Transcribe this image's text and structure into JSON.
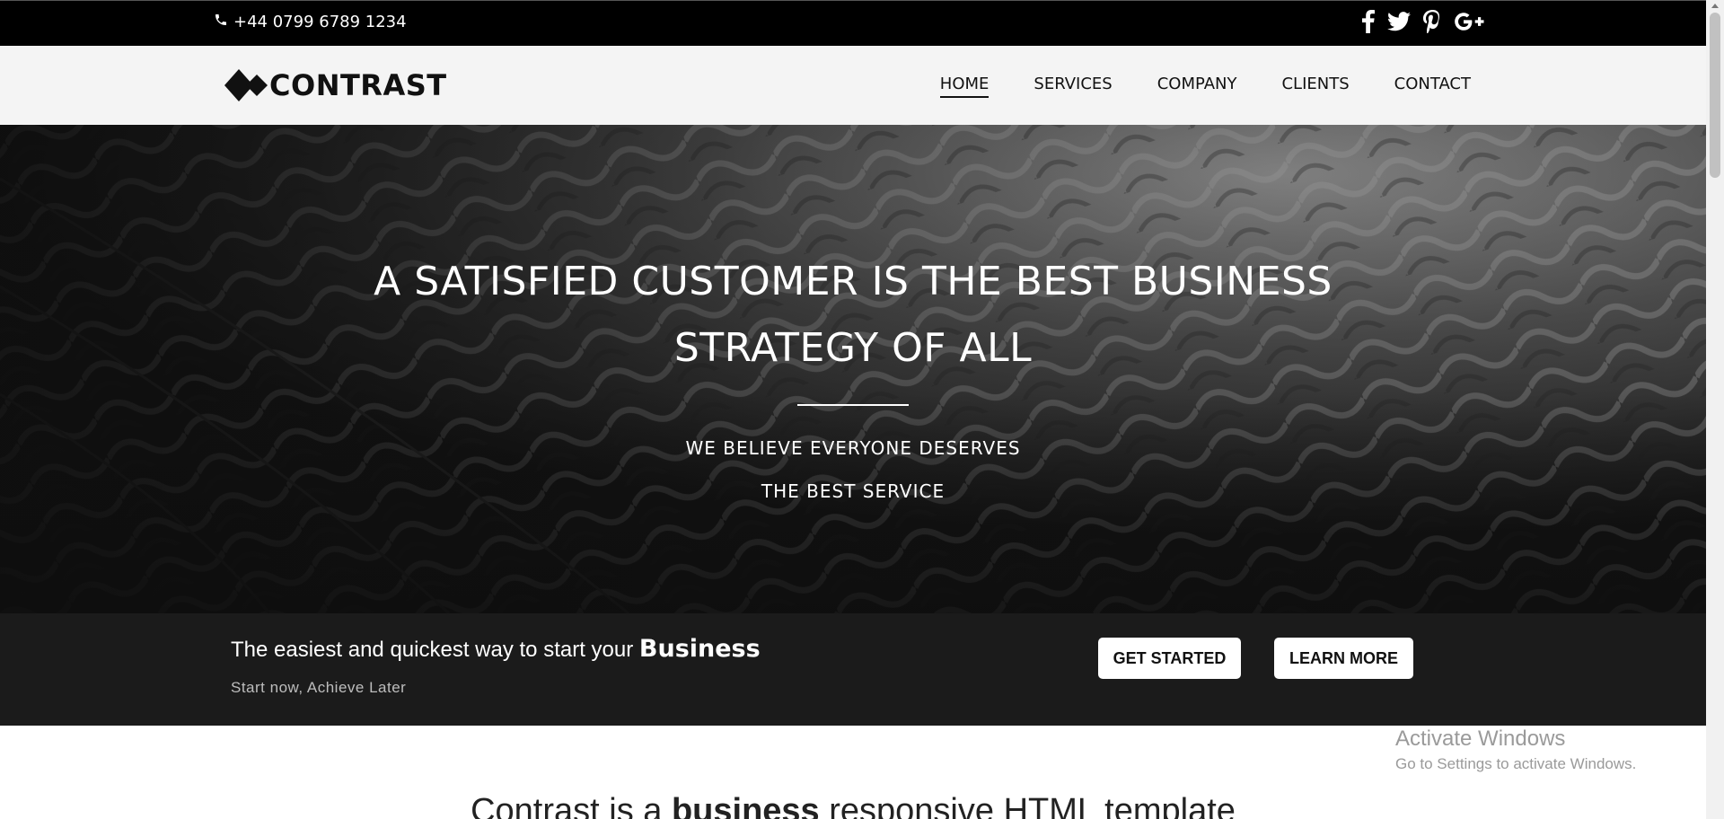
{
  "topbar": {
    "phone": "+44 0799 6789 1234",
    "socials": [
      "facebook-icon",
      "twitter-icon",
      "pinterest-icon",
      "google-plus-icon"
    ]
  },
  "header": {
    "logo_text": "CONTRAST",
    "nav": [
      {
        "label": "HOME",
        "active": true
      },
      {
        "label": "SERVICES"
      },
      {
        "label": "COMPANY"
      },
      {
        "label": "CLIENTS"
      },
      {
        "label": "CONTACT"
      }
    ]
  },
  "hero": {
    "title_line1": "A SATISFIED CUSTOMER IS THE BEST BUSINESS",
    "title_line2": "STRATEGY OF ALL",
    "subtitle_line1": "WE BELIEVE EVERYONE DESERVES",
    "subtitle_line2": "THE BEST SERVICE"
  },
  "cta": {
    "headline": "The easiest and quickest way to start your ",
    "headline_emphasis": "Business",
    "subline": "Start now, Achieve Later",
    "get_started": "GET STARTED",
    "learn_more": "LEARN MORE"
  },
  "intro": {
    "prefix": "Contrast is a ",
    "emphasis": "business",
    "suffix": " responsive HTML template"
  },
  "watermark": {
    "line1": "Activate Windows",
    "line2": "Go to Settings to activate Windows."
  },
  "colors": {
    "topbar": "#000000",
    "header": "#f4f4f4",
    "cta_band": "#1b1b1b",
    "text_light": "#ffffff"
  }
}
